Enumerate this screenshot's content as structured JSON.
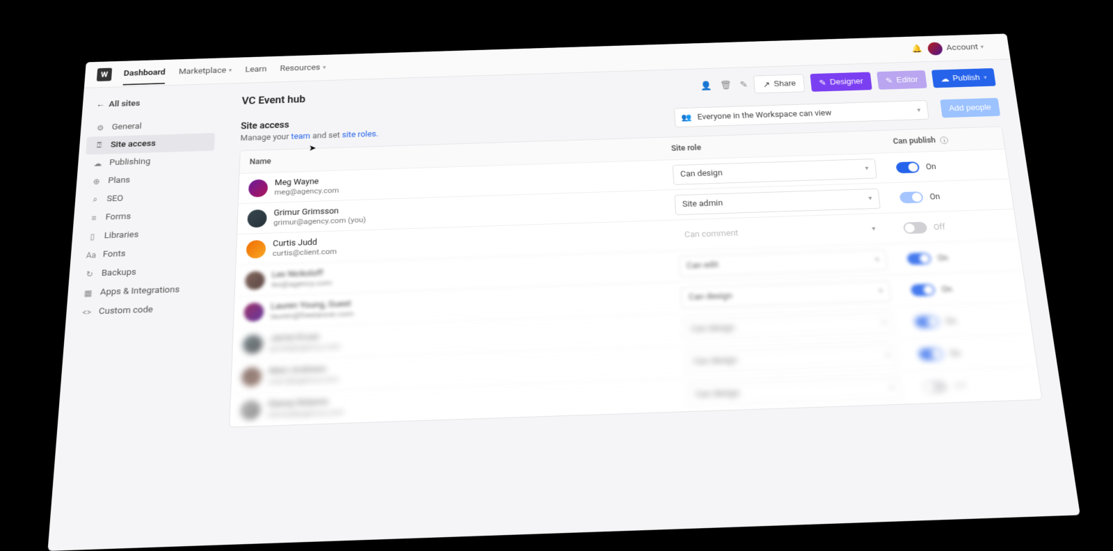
{
  "topnav": {
    "items": [
      "Dashboard",
      "Marketplace",
      "Learn",
      "Resources"
    ],
    "account_label": "Account"
  },
  "sidebar": {
    "back_label": "All sites",
    "items": [
      {
        "icon": "⚙",
        "label": "General"
      },
      {
        "icon": "⍰",
        "label": "Site access"
      },
      {
        "icon": "☁",
        "label": "Publishing"
      },
      {
        "icon": "⊕",
        "label": "Plans"
      },
      {
        "icon": "⌕",
        "label": "SEO"
      },
      {
        "icon": "≡",
        "label": "Forms"
      },
      {
        "icon": "▯",
        "label": "Libraries"
      },
      {
        "icon": "Aa",
        "label": "Fonts"
      },
      {
        "icon": "↻",
        "label": "Backups"
      },
      {
        "icon": "▦",
        "label": "Apps & Integrations"
      },
      {
        "icon": "<>",
        "label": "Custom code"
      }
    ],
    "active_index": 1
  },
  "page": {
    "title": "VC Event hub",
    "share_label": "Share",
    "designer_label": "Designer",
    "editor_label": "Editor",
    "publish_label": "Publish"
  },
  "section": {
    "title": "Site access",
    "sub_prefix": "Manage your ",
    "link1": "team",
    "sub_mid": " and set ",
    "link2": "site roles.",
    "workspace_selector": "Everyone in the Workspace can view",
    "add_people_label": "Add people"
  },
  "table": {
    "col_name": "Name",
    "col_role": "Site role",
    "col_publish": "Can publish",
    "rows": [
      {
        "name": "Meg Wayne",
        "email": "meg@agency.com",
        "role": "Can design",
        "publish": "On",
        "toggle": "on",
        "blur": 0,
        "ghost": false,
        "avatar": "av-a"
      },
      {
        "name": "Grimur Grimsson",
        "email": "grimur@agency.com (you)",
        "role": "Site admin",
        "publish": "On",
        "toggle": "locked",
        "blur": 0,
        "ghost": false,
        "avatar": "av-b"
      },
      {
        "name": "Curtis Judd",
        "email": "curtis@client.com",
        "role": "Can comment",
        "publish": "Off",
        "toggle": "off",
        "blur": 0,
        "ghost": true,
        "avatar": "av-c"
      },
      {
        "name": "Lex Nickoloff",
        "email": "lex@agency.com",
        "role": "Can edit",
        "publish": "On",
        "toggle": "on",
        "blur": 1,
        "ghost": false,
        "avatar": "av-d"
      },
      {
        "name": "Lauren Young, Guest",
        "email": "lauren@freelancer.com",
        "role": "Can design",
        "publish": "On",
        "toggle": "on",
        "blur": 1,
        "ghost": false,
        "avatar": "av-e"
      },
      {
        "name": "Jamie Kruse",
        "email": "jamie@agency.com",
        "role": "Can design",
        "publish": "On",
        "toggle": "on",
        "blur": 2,
        "ghost": false,
        "avatar": "av-f"
      },
      {
        "name": "Marc Andrews",
        "email": "marc@agency.com",
        "role": "Can design",
        "publish": "On",
        "toggle": "on",
        "blur": 2,
        "ghost": false,
        "avatar": "av-g"
      },
      {
        "name": "Stacey Roberts",
        "email": "stacey@agency.com",
        "role": "Can design",
        "publish": "Off",
        "toggle": "off",
        "blur": 2,
        "ghost": false,
        "avatar": "av-h"
      }
    ]
  }
}
